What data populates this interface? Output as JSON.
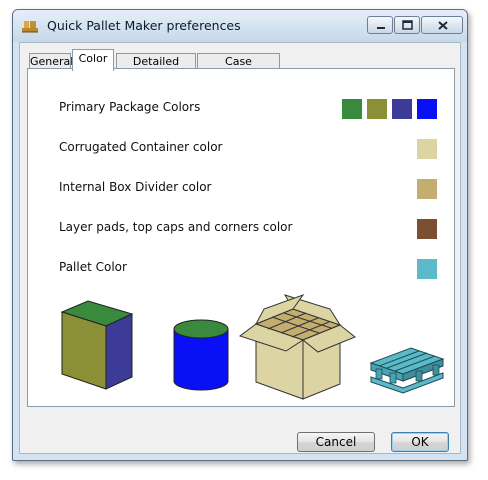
{
  "window": {
    "title": "Quick Pallet Maker preferences",
    "icon": "pallet-app-icon",
    "controls": [
      "minimize-icon",
      "maximize-icon",
      "close-icon"
    ]
  },
  "tabs": [
    {
      "label": "General",
      "active": false
    },
    {
      "label": "Color",
      "active": true
    },
    {
      "label": "Detailed Report",
      "active": false
    },
    {
      "label": "Case Constraints",
      "active": false
    }
  ],
  "color_settings": {
    "primary_package": {
      "label": "Primary Package Colors",
      "colors": [
        "#3a8a3d",
        "#8b8f35",
        "#3c3b98",
        "#0a10f5"
      ]
    },
    "corrugated": {
      "label": "Corrugated Container color",
      "color": "#dcd4a3"
    },
    "divider": {
      "label": "Internal Box Divider color",
      "color": "#c3ad6f"
    },
    "layer_pads": {
      "label": "Layer pads, top caps and corners color",
      "color": "#7c4f32"
    },
    "pallet": {
      "label": "Pallet Color",
      "color": "#5bb9c9"
    }
  },
  "preview_icons": [
    "box-illustration",
    "cylinder-illustration",
    "open-case-illustration",
    "pallet-illustration"
  ],
  "buttons": {
    "cancel": "Cancel",
    "ok": "OK"
  }
}
